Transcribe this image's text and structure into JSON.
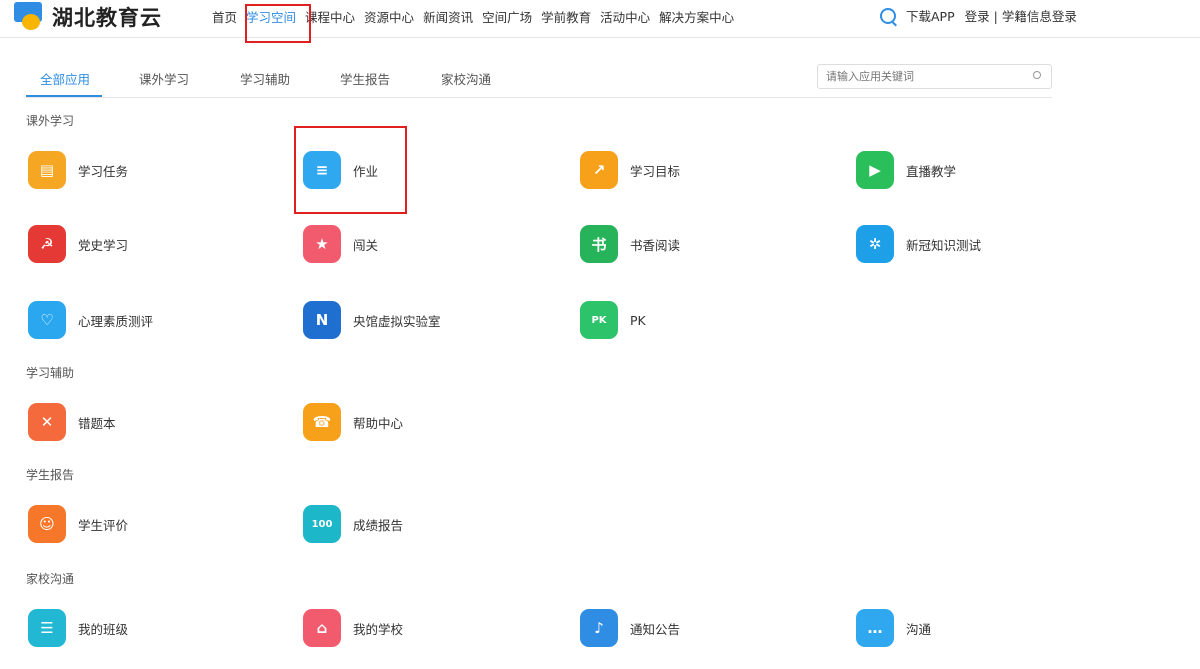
{
  "header": {
    "logo_text": "湖北教育云",
    "nav": [
      "首页",
      "学习空间",
      "课程中心",
      "资源中心",
      "新闻资讯",
      "空间广场",
      "学前教育",
      "活动中心",
      "解决方案中心"
    ],
    "active_nav": 1,
    "download": "下载APP",
    "login": "登录",
    "student_login": "| 学籍信息登录"
  },
  "tabs": [
    "全部应用",
    "课外学习",
    "学习辅助",
    "学生报告",
    "家校沟通"
  ],
  "search": {
    "placeholder": "请输入应用关键词"
  },
  "sections": [
    {
      "title": "课外学习",
      "apps": [
        {
          "label": "学习任务",
          "icon": "task-icon",
          "color": "#f5a623",
          "glyph": "▤"
        },
        {
          "label": "作业",
          "icon": "homework-icon",
          "color": "#2fa8f0",
          "glyph": "≡"
        },
        {
          "label": "学习目标",
          "icon": "target-icon",
          "color": "#f7a11a",
          "glyph": "↗"
        },
        {
          "label": "直播教学",
          "icon": "live-icon",
          "color": "#2bbf5b",
          "glyph": "▶"
        },
        {
          "label": "党史学习",
          "icon": "party-history-icon",
          "color": "#e53935",
          "glyph": "☭"
        },
        {
          "label": "闯关",
          "icon": "challenge-icon",
          "color": "#f25a6e",
          "glyph": "★"
        },
        {
          "label": "书香阅读",
          "icon": "reading-icon",
          "color": "#27b35a",
          "glyph": "书"
        },
        {
          "label": "新冠知识测试",
          "icon": "covid-quiz-icon",
          "color": "#1ea0e8",
          "glyph": "✲"
        },
        {
          "label": "心理素质测评",
          "icon": "psychology-icon",
          "color": "#2aa7ee",
          "glyph": "♡"
        },
        {
          "label": "央馆虚拟实验室",
          "icon": "ncet-lab-icon",
          "color": "#1f6fd1",
          "glyph": "N"
        },
        {
          "label": "PK",
          "icon": "pk-icon",
          "color": "#2cc36b",
          "glyph": "PK"
        }
      ]
    },
    {
      "title": "学习辅助",
      "apps": [
        {
          "label": "错题本",
          "icon": "wrong-book-icon",
          "color": "#f46a3c",
          "glyph": "✕"
        },
        {
          "label": "帮助中心",
          "icon": "help-icon",
          "color": "#f7a11a",
          "glyph": "☎"
        }
      ]
    },
    {
      "title": "学生报告",
      "apps": [
        {
          "label": "学生评价",
          "icon": "evaluation-icon",
          "color": "#f7772a",
          "glyph": "☺"
        },
        {
          "label": "成绩报告",
          "icon": "score-report-icon",
          "color": "#1cb7c9",
          "glyph": "100"
        }
      ]
    },
    {
      "title": "家校沟通",
      "apps": [
        {
          "label": "我的班级",
          "icon": "class-icon",
          "color": "#22b8d4",
          "glyph": "☰"
        },
        {
          "label": "我的学校",
          "icon": "school-icon",
          "color": "#f25a6e",
          "glyph": "⌂"
        },
        {
          "label": "通知公告",
          "icon": "notice-icon",
          "color": "#2f8de4",
          "glyph": "♪"
        },
        {
          "label": "沟通",
          "icon": "chat-icon",
          "color": "#2fa8f0",
          "glyph": "…"
        }
      ]
    }
  ]
}
